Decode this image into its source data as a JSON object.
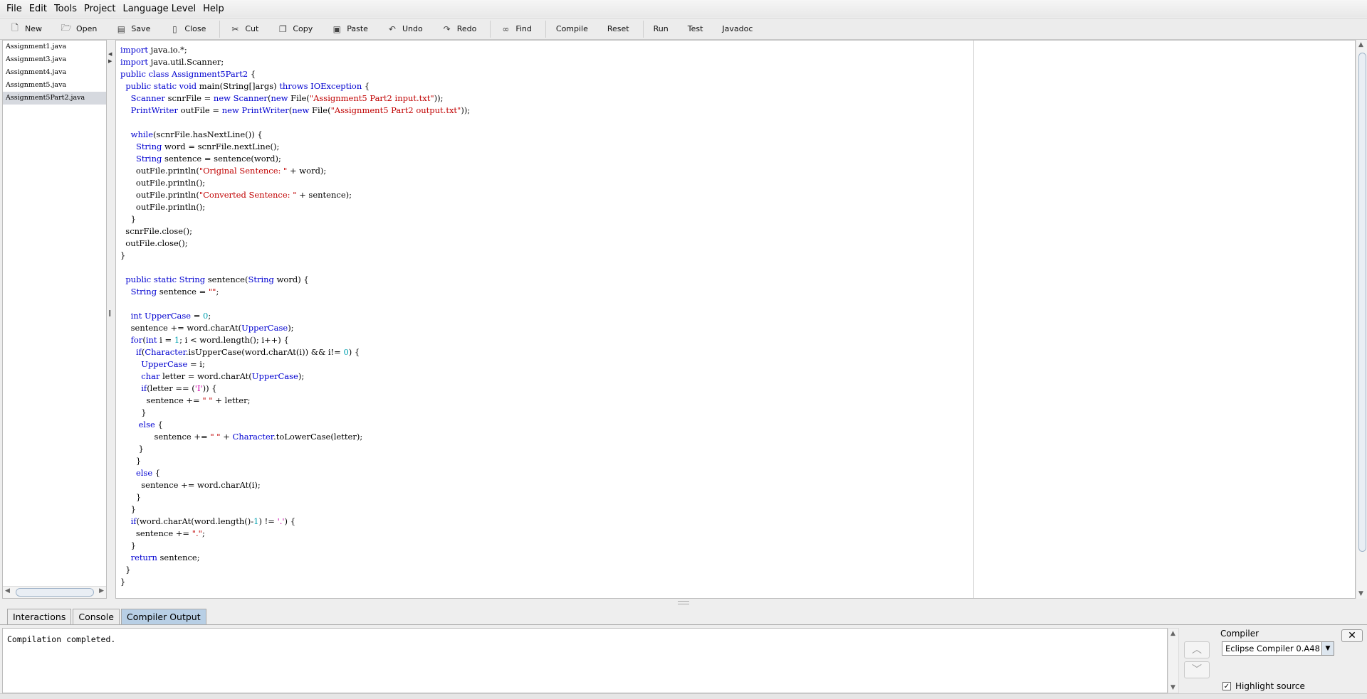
{
  "menu": [
    "File",
    "Edit",
    "Tools",
    "Project",
    "Language Level",
    "Help"
  ],
  "toolbar": {
    "groups": [
      [
        {
          "label": "New",
          "icon": "new-file-icon"
        },
        {
          "label": "Open",
          "icon": "open-folder-icon"
        },
        {
          "label": "Save",
          "icon": "save-disk-icon"
        },
        {
          "label": "Close",
          "icon": "close-file-icon"
        }
      ],
      [
        {
          "label": "Cut",
          "icon": "scissors-icon"
        },
        {
          "label": "Copy",
          "icon": "copy-icon"
        },
        {
          "label": "Paste",
          "icon": "paste-clipboard-icon"
        },
        {
          "label": "Undo",
          "icon": "undo-icon"
        },
        {
          "label": "Redo",
          "icon": "redo-icon"
        }
      ],
      [
        {
          "label": "Find",
          "icon": "binoculars-icon"
        }
      ],
      [
        {
          "label": "Compile"
        },
        {
          "label": "Reset"
        }
      ],
      [
        {
          "label": "Run"
        },
        {
          "label": "Test"
        },
        {
          "label": "Javadoc"
        }
      ]
    ]
  },
  "files": [
    "Assignment1.java",
    "Assignment3.java",
    "Assignment4.java",
    "Assignment5.java",
    "Assignment5Part2.java"
  ],
  "selected_file_index": 4,
  "code": [
    [
      [
        "kw",
        "import"
      ],
      [
        "p",
        " java.io.*;"
      ]
    ],
    [
      [
        "kw",
        "import"
      ],
      [
        "p",
        " java.util.Scanner;"
      ]
    ],
    [
      [
        "kw",
        "public class"
      ],
      [
        "p",
        " "
      ],
      [
        "kw",
        "Assignment5Part2"
      ],
      [
        "p",
        " {"
      ]
    ],
    [
      [
        "p",
        "  "
      ],
      [
        "kw",
        "public static void"
      ],
      [
        "p",
        " main(String[]args) "
      ],
      [
        "kw",
        "throws IOException"
      ],
      [
        "p",
        " {"
      ]
    ],
    [
      [
        "p",
        "    "
      ],
      [
        "kw",
        "Scanner"
      ],
      [
        "p",
        " scnrFile = "
      ],
      [
        "kw",
        "new Scanner"
      ],
      [
        "p",
        "("
      ],
      [
        "kw",
        "new"
      ],
      [
        "p",
        " File("
      ],
      [
        "str",
        "\"Assignment5 Part2 input.txt\""
      ],
      [
        "p",
        "));"
      ]
    ],
    [
      [
        "p",
        "    "
      ],
      [
        "kw",
        "PrintWriter"
      ],
      [
        "p",
        " outFile = "
      ],
      [
        "kw",
        "new PrintWriter"
      ],
      [
        "p",
        "("
      ],
      [
        "kw",
        "new"
      ],
      [
        "p",
        " File("
      ],
      [
        "str",
        "\"Assignment5 Part2 output.txt\""
      ],
      [
        "p",
        "));"
      ]
    ],
    [
      [
        "p",
        ""
      ]
    ],
    [
      [
        "p",
        "    "
      ],
      [
        "kw",
        "while"
      ],
      [
        "p",
        "(scnrFile.hasNextLine()) {"
      ]
    ],
    [
      [
        "p",
        "      "
      ],
      [
        "kw",
        "String"
      ],
      [
        "p",
        " word = scnrFile.nextLine();"
      ]
    ],
    [
      [
        "p",
        "      "
      ],
      [
        "kw",
        "String"
      ],
      [
        "p",
        " sentence = sentence(word);"
      ]
    ],
    [
      [
        "p",
        "      outFile.println("
      ],
      [
        "str",
        "\"Original Sentence: \""
      ],
      [
        "p",
        " + word);"
      ]
    ],
    [
      [
        "p",
        "      outFile.println();"
      ]
    ],
    [
      [
        "p",
        "      outFile.println("
      ],
      [
        "str",
        "\"Converted Sentence: \""
      ],
      [
        "p",
        " + sentence);"
      ]
    ],
    [
      [
        "p",
        "      outFile.println();"
      ]
    ],
    [
      [
        "p",
        "    }"
      ]
    ],
    [
      [
        "p",
        "  scnrFile.close();"
      ]
    ],
    [
      [
        "p",
        "  outFile.close();"
      ]
    ],
    [
      [
        "p",
        "}"
      ]
    ],
    [
      [
        "p",
        ""
      ]
    ],
    [
      [
        "p",
        "  "
      ],
      [
        "kw",
        "public static String"
      ],
      [
        "p",
        " sentence("
      ],
      [
        "kw",
        "String"
      ],
      [
        "p",
        " word) {"
      ]
    ],
    [
      [
        "p",
        "    "
      ],
      [
        "kw",
        "String"
      ],
      [
        "p",
        " sentence = "
      ],
      [
        "str",
        "\"\""
      ],
      [
        "p",
        ";"
      ]
    ],
    [
      [
        "p",
        ""
      ]
    ],
    [
      [
        "p",
        "    "
      ],
      [
        "kw",
        "int UpperCase"
      ],
      [
        "p",
        " = "
      ],
      [
        "num",
        "0"
      ],
      [
        "p",
        ";"
      ]
    ],
    [
      [
        "p",
        "    sentence += word.charAt("
      ],
      [
        "kw",
        "UpperCase"
      ],
      [
        "p",
        ");"
      ]
    ],
    [
      [
        "p",
        "    "
      ],
      [
        "kw",
        "for"
      ],
      [
        "p",
        "("
      ],
      [
        "kw",
        "int"
      ],
      [
        "p",
        " i = "
      ],
      [
        "num",
        "1"
      ],
      [
        "p",
        "; i < word.length(); i++) {"
      ]
    ],
    [
      [
        "p",
        "      "
      ],
      [
        "kw",
        "if"
      ],
      [
        "p",
        "("
      ],
      [
        "kw",
        "Character"
      ],
      [
        "p",
        ".isUpperCase(word.charAt(i)) && i!= "
      ],
      [
        "num",
        "0"
      ],
      [
        "p",
        ") {"
      ]
    ],
    [
      [
        "p",
        "        "
      ],
      [
        "kw",
        "UpperCase"
      ],
      [
        "p",
        " = i;"
      ]
    ],
    [
      [
        "p",
        "        "
      ],
      [
        "kw",
        "char"
      ],
      [
        "p",
        " letter = word.charAt("
      ],
      [
        "kw",
        "UpperCase"
      ],
      [
        "p",
        ");"
      ]
    ],
    [
      [
        "p",
        "        "
      ],
      [
        "kw",
        "if"
      ],
      [
        "p",
        "(letter == ("
      ],
      [
        "chr",
        "'I'"
      ],
      [
        "p",
        ")) {"
      ]
    ],
    [
      [
        "p",
        "          sentence += "
      ],
      [
        "str",
        "\" \""
      ],
      [
        "p",
        " + letter;"
      ]
    ],
    [
      [
        "p",
        "        }"
      ]
    ],
    [
      [
        "p",
        "       "
      ],
      [
        "kw",
        "else"
      ],
      [
        "p",
        " {"
      ]
    ],
    [
      [
        "p",
        "             sentence += "
      ],
      [
        "str",
        "\" \""
      ],
      [
        "p",
        " + "
      ],
      [
        "kw",
        "Character"
      ],
      [
        "p",
        ".toLowerCase(letter);"
      ]
    ],
    [
      [
        "p",
        "       }"
      ]
    ],
    [
      [
        "p",
        "      }"
      ]
    ],
    [
      [
        "p",
        "      "
      ],
      [
        "kw",
        "else"
      ],
      [
        "p",
        " {"
      ]
    ],
    [
      [
        "p",
        "        sentence += word.charAt(i);"
      ]
    ],
    [
      [
        "p",
        "      }"
      ]
    ],
    [
      [
        "p",
        "    }"
      ]
    ],
    [
      [
        "p",
        "    "
      ],
      [
        "kw",
        "if"
      ],
      [
        "p",
        "(word.charAt(word.length()-"
      ],
      [
        "num",
        "1"
      ],
      [
        "p",
        ") != "
      ],
      [
        "chr",
        "'.'"
      ],
      [
        "p",
        ") {"
      ]
    ],
    [
      [
        "p",
        "      sentence += "
      ],
      [
        "str",
        "\".\""
      ],
      [
        "p",
        ";"
      ]
    ],
    [
      [
        "p",
        "    }"
      ]
    ],
    [
      [
        "p",
        "    "
      ],
      [
        "kw",
        "return"
      ],
      [
        "p",
        " sentence;"
      ]
    ],
    [
      [
        "p",
        "  }"
      ]
    ],
    [
      [
        "p",
        "}"
      ]
    ]
  ],
  "tabs": [
    "Interactions",
    "Console",
    "Compiler Output"
  ],
  "active_tab": 2,
  "output": {
    "text": "Compilation completed."
  },
  "compiler_panel": {
    "label": "Compiler",
    "selected": "Eclipse Compiler 0.A48",
    "highlight_label": "Highlight source",
    "highlight_checked": true
  },
  "colors": {
    "keyword": "#0000d0",
    "string": "#c00000",
    "number": "#00a0b0",
    "char": "#cc00aa",
    "active_tab": "#b8cfe5"
  }
}
